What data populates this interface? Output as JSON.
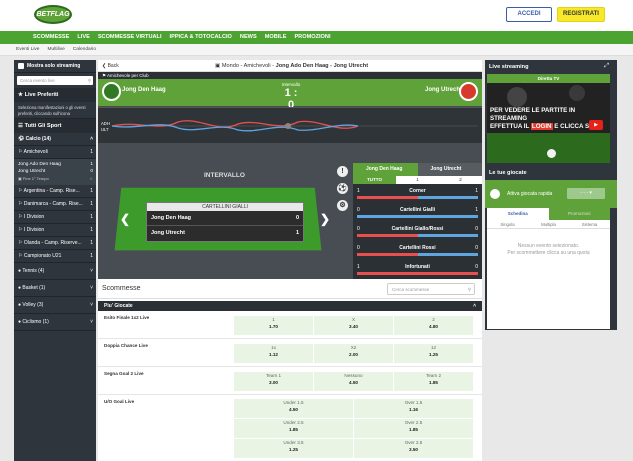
{
  "header": {
    "logo": "BETFLAG",
    "login": "ACCEDI",
    "register": "REGISTRATI"
  },
  "nav": [
    "SCOMMESSE",
    "LIVE",
    "SCOMMESSE VIRTUALI",
    "IPPICA & TOTOCALCIO",
    "NEWS",
    "MOBILE",
    "PROMOZIONI"
  ],
  "subnav": [
    "Eventi Live",
    "Multilive",
    "Calendario"
  ],
  "sidebar": {
    "streaming": "Mostra solo streaming",
    "search": "Cerca evento live",
    "preferiti": "Live Preferiti",
    "preferiti_note": "Seleziona manifestazioni o gli eventi preferiti, cliccando sull'icona",
    "tutti": "Tutti Gli Sport",
    "calcio": "Calcio (14)",
    "amichevoli": "Amichevoli",
    "amichevoli_count": "1",
    "match": {
      "home": "Jong Ado Den Haag",
      "home_score": "1",
      "away": "Jong Utrecht",
      "away_score": "0",
      "period": "Fine 1° Tempo"
    },
    "leagues": [
      {
        "name": "Argentina - Camp. Rise...",
        "count": "1"
      },
      {
        "name": "Danimarca - Camp. Rise...",
        "count": "1"
      },
      {
        "name": "I Division",
        "count": "1"
      },
      {
        "name": "I Division",
        "count": "1"
      },
      {
        "name": "Olanda - Camp. Riserve...",
        "count": "1"
      },
      {
        "name": "Campionato U21",
        "count": "1"
      }
    ],
    "sports": [
      "Tennis (4)",
      "Basket (1)",
      "Volley (3)",
      "Ciclismo (1)"
    ]
  },
  "breadcrumb": {
    "back": "Back",
    "path": "Mondo - Amichevoli - ",
    "event": "Jong Ado Den Haag - Jong Utrecht"
  },
  "event": {
    "competition": "Amichevole per Club",
    "home": "Jong Den Haag",
    "away": "Jong Utrecht",
    "status": "Intervallo",
    "score": "1 : 0",
    "timeline_home": "ADH",
    "timeline_away": "ULT",
    "field_status": "INTERVALLO",
    "cards_title": "CARTELLINI GIALLI",
    "cards": [
      {
        "team": "Jong Den Haag",
        "value": "0"
      },
      {
        "team": "Jong Utrecht",
        "value": "1"
      }
    ]
  },
  "stats": {
    "home": "Jong Den Haag",
    "away": "Jong Utrecht",
    "tabs": [
      "TUTTO",
      "1",
      "2"
    ],
    "rows": [
      {
        "name": "Corner",
        "home": "1",
        "away": "1",
        "home_frac": 0.5
      },
      {
        "name": "Cartellini Gialli",
        "home": "0",
        "away": "1",
        "home_frac": 0.0
      },
      {
        "name": "Cartellini Giallo/Rossi",
        "home": "0",
        "away": "0",
        "home_frac": 0.5
      },
      {
        "name": "Cartellini Rossi",
        "home": "0",
        "away": "0",
        "home_frac": 0.5
      },
      {
        "name": "Infortunati",
        "home": "1",
        "away": "0",
        "home_frac": 1.0
      }
    ]
  },
  "markets": {
    "title": "Scommesse",
    "search": "Cerca scommesse",
    "group": "Piu' Giocate",
    "list": [
      {
        "label": "Esito Finale 1x2 Live",
        "odds": [
          {
            "k": "1",
            "v": "1.70"
          },
          {
            "k": "X",
            "v": "3.40"
          },
          {
            "k": "2",
            "v": "4.80"
          }
        ]
      },
      {
        "label": "Doppia Chance Live",
        "odds": [
          {
            "k": "1x",
            "v": "1.12"
          },
          {
            "k": "X2",
            "v": "2.00"
          },
          {
            "k": "12",
            "v": "1.25"
          }
        ]
      },
      {
        "label": "Segna Goal 2 Live",
        "odds": [
          {
            "k": "Team 1",
            "v": "3.00"
          },
          {
            "k": "Nessuno",
            "v": "4.50"
          },
          {
            "k": "Team 2",
            "v": "1.85"
          }
        ]
      },
      {
        "label": "U/O Goal Live",
        "odds": [
          {
            "k": "Under 1.5",
            "v": "4.50"
          },
          {
            "k": "Over 1.5",
            "v": "1.16"
          },
          {
            "k": "Under 2.5",
            "v": "1.85"
          },
          {
            "k": "Over 2.5",
            "v": "1.85"
          },
          {
            "k": "Under 3.5",
            "v": "1.25"
          },
          {
            "k": "Over 3.5",
            "v": "3.50"
          }
        ]
      }
    ]
  },
  "right": {
    "live_title": "Live streaming",
    "tv": "Diretta TV",
    "promo_lines": [
      "PER VEDERE LE PARTITE IN STREAMING",
      "EFFETTUA IL",
      "LOGIN",
      "E CLICCA SU"
    ],
    "giocate_title": "Le tue giocate",
    "quick": "Attiva giocata rapida",
    "quick_value": "- - -",
    "tabs": [
      "Schedina",
      "Promozioni"
    ],
    "subtabs": [
      "Singola",
      "Multipla",
      "Sistema"
    ],
    "empty1": "Nessun evento selezionato.",
    "empty2": "Per scommettere clicca su una quota"
  }
}
